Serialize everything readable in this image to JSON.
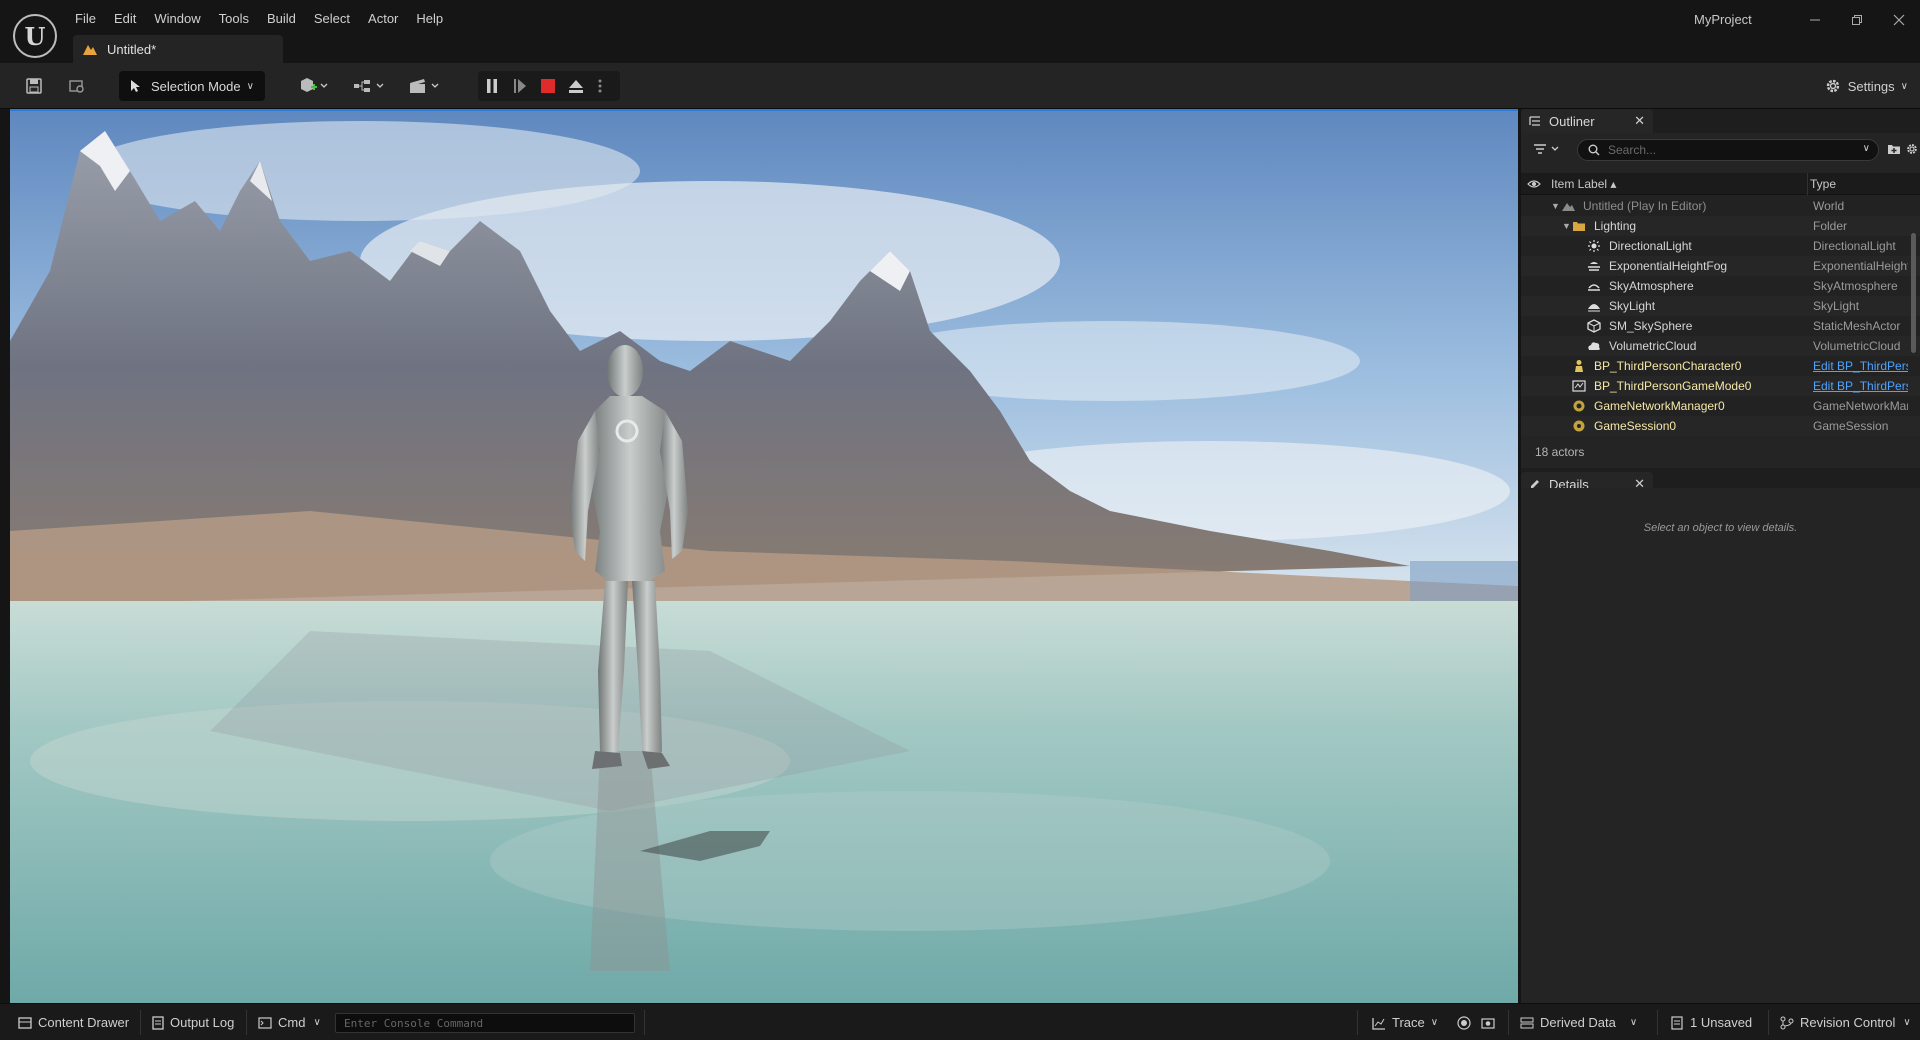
{
  "app": {
    "project_name": "MyProject",
    "logo_letter": "U",
    "menu": [
      "File",
      "Edit",
      "Window",
      "Tools",
      "Build",
      "Select",
      "Actor",
      "Help"
    ],
    "doc_tab": "Untitled*"
  },
  "toolbar": {
    "selection_mode": "Selection Mode",
    "settings": "Settings"
  },
  "outliner": {
    "title": "Outliner",
    "search_placeholder": "Search...",
    "col_label": "Item Label ▴",
    "col_type": "Type",
    "rows": [
      {
        "name": "Untitled (Play In Editor)",
        "type": "World",
        "indent": 0,
        "arrow": "▼",
        "icon": "world-icon",
        "dim": true
      },
      {
        "name": "Lighting",
        "type": "Folder",
        "indent": 1,
        "arrow": "▼",
        "icon": "folder-icon"
      },
      {
        "name": "DirectionalLight",
        "type": "DirectionalLight",
        "indent": 2,
        "icon": "directional-light-icon"
      },
      {
        "name": "ExponentialHeightFog",
        "type": "ExponentialHeightFog",
        "indent": 2,
        "icon": "fog-icon"
      },
      {
        "name": "SkyAtmosphere",
        "type": "SkyAtmosphere",
        "indent": 2,
        "icon": "sky-atmosphere-icon"
      },
      {
        "name": "SkyLight",
        "type": "SkyLight",
        "indent": 2,
        "icon": "skylight-icon"
      },
      {
        "name": "SM_SkySphere",
        "type": "StaticMeshActor",
        "indent": 2,
        "icon": "static-mesh-icon"
      },
      {
        "name": "VolumetricCloud",
        "type": "VolumetricCloud",
        "indent": 2,
        "icon": "cloud-icon"
      },
      {
        "name": "BP_ThirdPersonCharacter0",
        "type": "Edit BP_ThirdPersonCharacter",
        "indent": 1,
        "icon": "character-icon",
        "highlight": true,
        "link": true
      },
      {
        "name": "BP_ThirdPersonGameMode0",
        "type": "Edit BP_ThirdPersonGameMode",
        "indent": 1,
        "icon": "gamemode-icon",
        "highlight": true,
        "link": true
      },
      {
        "name": "GameNetworkManager0",
        "type": "GameNetworkManager",
        "indent": 1,
        "icon": "network-icon",
        "highlight": true
      },
      {
        "name": "GameSession0",
        "type": "GameSession",
        "indent": 1,
        "icon": "session-icon",
        "highlight": true
      }
    ],
    "actor_count": "18 actors"
  },
  "details": {
    "title": "Details",
    "empty_text": "Select an object to view details."
  },
  "statusbar": {
    "content_drawer": "Content Drawer",
    "output_log": "Output Log",
    "cmd": "Cmd",
    "console_placeholder": "Enter Console Command",
    "trace": "Trace",
    "derived_data": "Derived Data",
    "unsaved": "1 Unsaved",
    "revision_control": "Revision Control"
  },
  "colors": {
    "accent_blue": "#2b7dd9",
    "stop_red": "#e02b2b",
    "highlight_text": "#f5e8a8",
    "link_blue": "#4ea3ff"
  }
}
